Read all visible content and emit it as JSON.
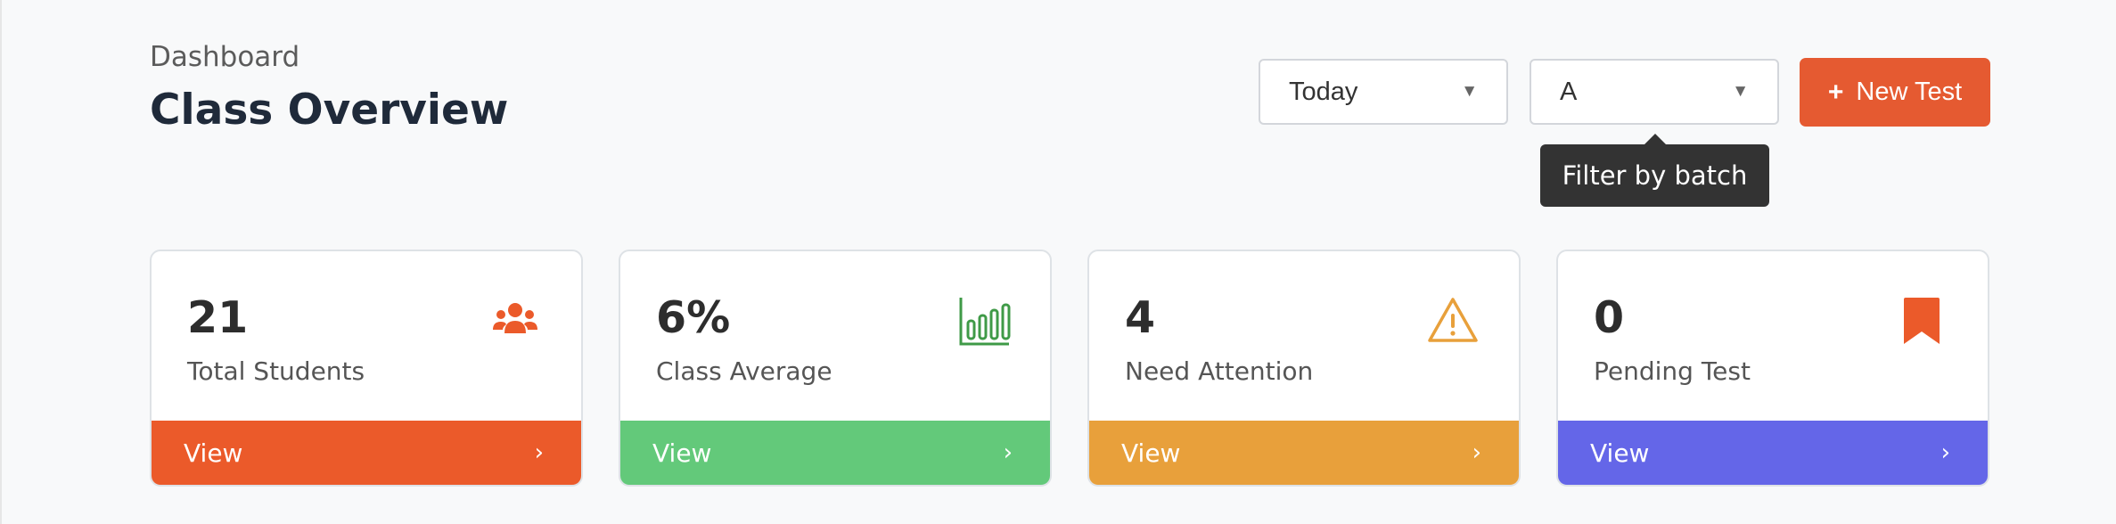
{
  "header": {
    "breadcrumb": "Dashboard",
    "title": "Class Overview"
  },
  "filters": {
    "period": {
      "value": "Today"
    },
    "batch": {
      "value": "A",
      "tooltip": "Filter by batch"
    }
  },
  "actions": {
    "new_test_label": "New Test"
  },
  "cards": [
    {
      "value": "21",
      "label": "Total Students",
      "link": "View",
      "color": "#eb5a2a",
      "icon": "users-icon"
    },
    {
      "value": "6%",
      "label": "Class Average",
      "link": "View",
      "color": "#63c97a",
      "icon": "bar-chart-icon"
    },
    {
      "value": "4",
      "label": "Need Attention",
      "link": "View",
      "color": "#e8a03b",
      "icon": "warning-icon"
    },
    {
      "value": "0",
      "label": "Pending Test",
      "link": "View",
      "color": "#6466e8",
      "icon": "bookmark-icon"
    }
  ]
}
